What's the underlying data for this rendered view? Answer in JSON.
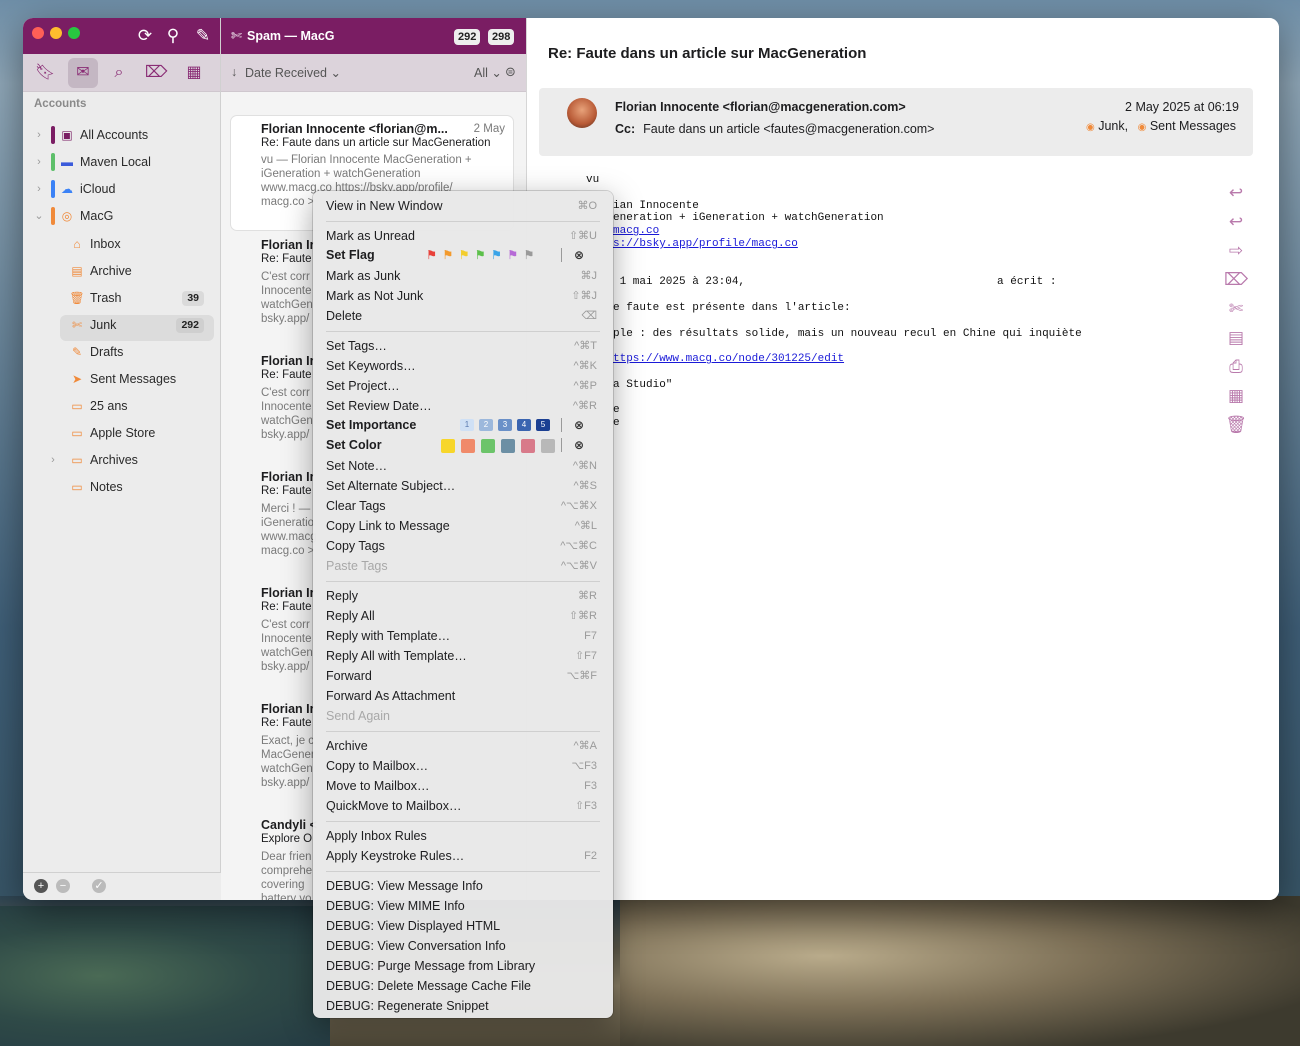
{
  "sidebar": {
    "section_label": "Accounts",
    "accounts": [
      {
        "label": "All Accounts",
        "color": "#7a1d63"
      },
      {
        "label": "Maven Local",
        "color": "#5dbf6a"
      },
      {
        "label": "iCloud",
        "color": "#3b82f6"
      },
      {
        "label": "MacG",
        "color": "#f08a3a"
      }
    ],
    "mailboxes": [
      {
        "label": "Inbox"
      },
      {
        "label": "Archive"
      },
      {
        "label": "Trash",
        "badge": "39"
      },
      {
        "label": "Junk",
        "badge": "292"
      },
      {
        "label": "Drafts"
      },
      {
        "label": "Sent Messages"
      },
      {
        "label": "25 ans"
      },
      {
        "label": "Apple Store"
      },
      {
        "label": "Archives"
      },
      {
        "label": "Notes"
      }
    ]
  },
  "list": {
    "title": "Spam — MacG",
    "count_unread": "292",
    "count_total": "298",
    "sort_label": "Date Received",
    "filter_label": "All",
    "messages": [
      {
        "from": "Florian Innocente <florian@m...",
        "date": "2 May",
        "subject": "Re: Faute dans un article sur MacGeneration",
        "preview1": "vu — Florian Innocente MacGeneration +",
        "preview2": "iGeneration + watchGeneration",
        "preview3": "www.macg.co https://bsky.app/profile/",
        "preview4": "macg.co >"
      },
      {
        "from": "Florian Ir",
        "subject": "Re: Faute",
        "preview1": "C'est corr",
        "preview2": "Innocente",
        "preview3": "watchGen",
        "preview4": "bsky.app/"
      },
      {
        "from": "Florian Ir",
        "subject": "Re: Faute",
        "preview1": "C'est corr",
        "preview2": "Innocente",
        "preview3": "watchGen",
        "preview4": "bsky.app/"
      },
      {
        "from": "Florian Ir",
        "subject": "Re: Faute",
        "preview1": "Merci ! —",
        "preview2": "iGeneratio",
        "preview3": "www.macg",
        "preview4": "macg.co >"
      },
      {
        "from": "Florian Ir",
        "subject": "Re: Faute",
        "preview1": "C'est corr",
        "preview2": "Innocente",
        "preview3": "watchGen",
        "preview4": "bsky.app/"
      },
      {
        "from": "Florian Ir",
        "subject": "Re: Faute",
        "preview1": "Exact, je c",
        "preview2": "MacGener",
        "preview3": "watchGen",
        "preview4": "bsky.app/"
      },
      {
        "from": "Candyli <",
        "subject": "Explore O",
        "preview1": "Dear frien",
        "preview2": "comprehe",
        "preview3": "covering",
        "preview4": "battery vo"
      }
    ]
  },
  "reader": {
    "title": "Re: Faute dans un article sur MacGeneration",
    "from": "Florian Innocente <florian@macgeneration.com>",
    "cc_label": "Cc:",
    "cc": "Faute dans un article <fautes@macgeneration.com>",
    "date": "2 May 2025 at 06:19",
    "tag1": "Junk",
    "tag_sep": ",",
    "tag2": "Sent Messages",
    "body": {
      "l1": "vu",
      "l2": "ian Innocente",
      "l3": "eneration + iGeneration + watchGeneration",
      "l4": "macg.co",
      "l5": "s://bsky.app/profile/macg.co",
      "l6a": " 1 mai 2025 à 23:04,",
      "l6b": "a écrit :",
      "l7": "e faute est présente dans l'article:",
      "l8": "ple : des résultats solide, mais un nouveau recul en Chine qui inquiète",
      "l9": "ttps://www.macg.co/node/301225/edit",
      "l10": "a Studio\"",
      "l11": "e"
    }
  },
  "menu": {
    "items": [
      {
        "label": "View in New Window",
        "shortcut": "⌘O"
      },
      {
        "label": "Mark as Unread",
        "shortcut": "⇧⌘U"
      },
      {
        "label": "Set Flag"
      },
      {
        "label": "Mark as Junk",
        "shortcut": "⌘J"
      },
      {
        "label": "Mark as Not Junk",
        "shortcut": "⇧⌘J"
      },
      {
        "label": "Delete",
        "shortcut": "⌫"
      },
      {
        "label": "Set Tags…",
        "shortcut": "^⌘T"
      },
      {
        "label": "Set Keywords…",
        "shortcut": "^⌘K"
      },
      {
        "label": "Set Project…",
        "shortcut": "^⌘P"
      },
      {
        "label": "Set Review Date…",
        "shortcut": "^⌘R"
      },
      {
        "label": "Set Importance"
      },
      {
        "label": "Set Color"
      },
      {
        "label": "Set Note…",
        "shortcut": "^⌘N"
      },
      {
        "label": "Set Alternate Subject…",
        "shortcut": "^⌘S"
      },
      {
        "label": "Clear Tags",
        "shortcut": "^⌥⌘X"
      },
      {
        "label": "Copy Link to Message",
        "shortcut": "^⌘L"
      },
      {
        "label": "Copy Tags",
        "shortcut": "^⌥⌘C"
      },
      {
        "label": "Paste Tags",
        "shortcut": "^⌥⌘V"
      },
      {
        "label": "Reply",
        "shortcut": "⌘R"
      },
      {
        "label": "Reply All",
        "shortcut": "⇧⌘R"
      },
      {
        "label": "Reply with Template…",
        "shortcut": "F7"
      },
      {
        "label": "Reply All with Template…",
        "shortcut": "⇧F7"
      },
      {
        "label": "Forward",
        "shortcut": "⌥⌘F"
      },
      {
        "label": "Forward As Attachment",
        "shortcut": ""
      },
      {
        "label": "Send Again",
        "shortcut": ""
      },
      {
        "label": "Archive",
        "shortcut": "^⌘A"
      },
      {
        "label": "Copy to Mailbox…",
        "shortcut": "⌥F3"
      },
      {
        "label": "Move to Mailbox…",
        "shortcut": "F3"
      },
      {
        "label": "QuickMove to Mailbox…",
        "shortcut": "⇧F3"
      },
      {
        "label": "Apply Inbox Rules",
        "shortcut": ""
      },
      {
        "label": "Apply Keystroke Rules…",
        "shortcut": "F2"
      },
      {
        "label": "DEBUG: View Message Info"
      },
      {
        "label": "DEBUG: View MIME Info"
      },
      {
        "label": "DEBUG: View Displayed HTML"
      },
      {
        "label": "DEBUG: View Conversation Info"
      },
      {
        "label": "DEBUG: Purge Message from Library"
      },
      {
        "label": "DEBUG: Delete Message Cache File"
      },
      {
        "label": "DEBUG: Regenerate Snippet"
      }
    ],
    "importance_levels": [
      "1",
      "2",
      "3",
      "4",
      "5"
    ],
    "flag_colors": [
      "#e8413a",
      "#f39a2c",
      "#f3cd2c",
      "#5cc04a",
      "#3aa4e8",
      "#b66ad6",
      "#9a9a9a"
    ],
    "color_swatches": [
      "#f7d62a",
      "#f08a6a",
      "#6cc46a",
      "#6c8fa4",
      "#d87a8a",
      "#b8b8b8"
    ]
  },
  "colors": {
    "accent": "#7a1d63",
    "tab_bar": "#dcd3db",
    "unread_dot": "#1f7cf5"
  }
}
